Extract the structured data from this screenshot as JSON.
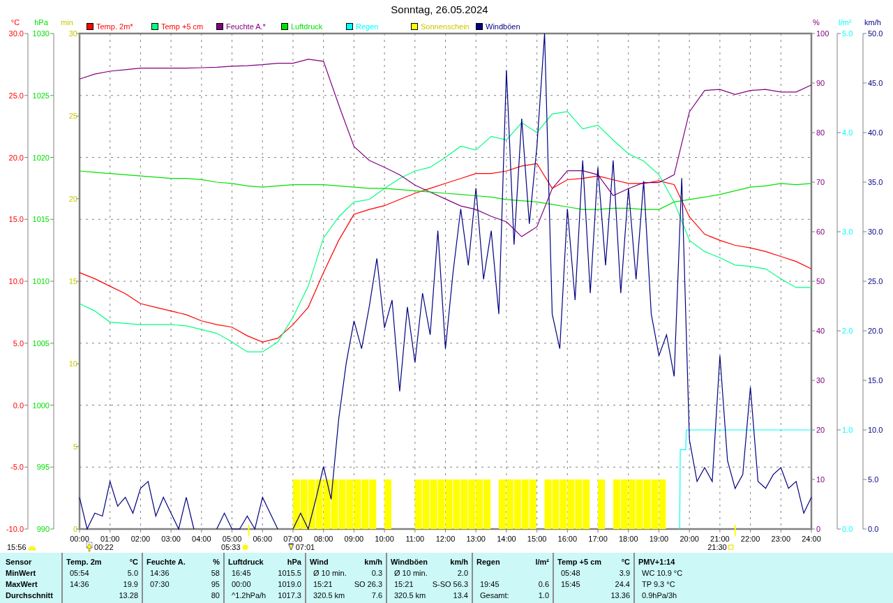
{
  "chart_layers": [
    {
      "chart_data": {
        "type": "line",
        "title": "Sonntag, 26.05.2024",
        "ylabel": "°C",
        "legend": "top",
        "grid": true,
        "x": [
          0,
          0.5,
          1,
          1.5,
          2,
          2.5,
          3,
          3.5,
          4,
          4.5,
          5,
          5.5,
          6,
          6.5,
          7,
          7.5,
          8,
          8.5,
          9,
          9.5,
          10,
          10.5,
          11,
          11.5,
          12,
          12.5,
          13,
          13.5,
          14,
          14.5,
          15,
          15.5,
          16,
          16.5,
          17,
          17.5,
          18,
          18.5,
          19,
          19.5,
          20,
          20.5,
          21,
          21.5,
          22,
          22.5,
          23,
          23.5,
          24
        ],
        "xlim": [
          0,
          24
        ],
        "xticks": [
          {
            "value": 0,
            "label": "00:00"
          },
          {
            "value": 1,
            "label": "01:00"
          },
          {
            "value": 2,
            "label": "02:00"
          },
          {
            "value": 3,
            "label": "03:00"
          },
          {
            "value": 4,
            "label": "04:00"
          },
          {
            "value": 5,
            "label": "05:00"
          },
          {
            "value": 6,
            "label": "06:00"
          },
          {
            "value": 7,
            "label": "07:00"
          },
          {
            "value": 8,
            "label": "08:00"
          },
          {
            "value": 9,
            "label": "09:00"
          },
          {
            "value": 10,
            "label": "10:00"
          },
          {
            "value": 11,
            "label": "11:00"
          },
          {
            "value": 12,
            "label": "12:00"
          },
          {
            "value": 13,
            "label": "13:00"
          },
          {
            "value": 14,
            "label": "14:00"
          },
          {
            "value": 15,
            "label": "15:00"
          },
          {
            "value": 16,
            "label": "16:00"
          },
          {
            "value": 17,
            "label": "17:00"
          },
          {
            "value": 18,
            "label": "18:00"
          },
          {
            "value": 19,
            "label": "19:00"
          },
          {
            "value": 20,
            "label": "20:00"
          },
          {
            "value": 21,
            "label": "21:00"
          },
          {
            "value": 22,
            "label": "22:00"
          },
          {
            "value": 23,
            "label": "23:00"
          },
          {
            "value": 24,
            "label": "24:00"
          }
        ],
        "ylim": [
          -10,
          30
        ],
        "yticks": [
          {
            "value": 30,
            "label": "30.0"
          },
          {
            "value": 25,
            "label": "25.0"
          },
          {
            "value": 20,
            "label": "20.0"
          },
          {
            "value": 15,
            "label": "15.0"
          },
          {
            "value": 10,
            "label": "10.0"
          },
          {
            "value": 5,
            "label": "5.0"
          },
          {
            "value": 0,
            "label": "0.0"
          },
          {
            "value": -5,
            "label": "-5.0"
          },
          {
            "value": -10,
            "label": "-10.0"
          }
        ],
        "series": [
          {
            "name": "Temp. 2m*",
            "color": "#ff0000",
            "values": [
              10.7,
              10.2,
              9.6,
              9.0,
              8.2,
              7.9,
              7.6,
              7.3,
              6.8,
              6.5,
              6.3,
              5.6,
              5.1,
              5.4,
              6.5,
              7.9,
              10.7,
              13.3,
              15.4,
              15.8,
              16.1,
              16.6,
              17.1,
              17.5,
              17.9,
              18.3,
              18.7,
              18.7,
              18.9,
              19.3,
              19.5,
              17.5,
              18.2,
              18.3,
              18.5,
              18.2,
              17.9,
              17.9,
              18.1,
              17.8,
              15.2,
              13.8,
              13.3,
              12.9,
              12.7,
              12.4,
              12.0,
              11.6,
              11.0
            ]
          },
          {
            "name": "Temp +5 cm",
            "color": "#00ff80",
            "values": [
              8.2,
              7.6,
              6.7,
              6.6,
              6.5,
              6.5,
              6.5,
              6.4,
              6.1,
              5.8,
              5.1,
              4.3,
              4.3,
              5.1,
              7.1,
              9.6,
              13.5,
              15.2,
              16.4,
              16.6,
              17.5,
              18.3,
              18.9,
              19.2,
              20.0,
              20.9,
              20.6,
              21.7,
              21.4,
              22.8,
              22.0,
              23.5,
              23.7,
              22.3,
              22.6,
              21.4,
              20.3,
              19.7,
              18.6,
              16.4,
              13.3,
              12.4,
              11.9,
              11.3,
              11.2,
              11.0,
              10.2,
              9.5,
              9.5
            ]
          }
        ],
        "annotations": [
          "00:22",
          "05:33",
          "07:01",
          "21:30"
        ]
      }
    },
    {
      "chart_data": {
        "type": "line",
        "ylabel": "%",
        "legend": "top",
        "x": [
          0,
          0.5,
          1,
          1.5,
          2,
          2.5,
          3,
          3.5,
          4,
          4.5,
          5,
          5.5,
          6,
          6.5,
          7,
          7.5,
          8,
          8.5,
          9,
          9.5,
          10,
          10.5,
          11,
          11.5,
          12,
          12.5,
          13,
          13.5,
          14,
          14.5,
          15,
          15.5,
          16,
          16.5,
          17,
          17.5,
          18,
          18.5,
          19,
          19.5,
          20,
          20.5,
          21,
          21.5,
          22,
          22.5,
          23,
          23.5,
          24
        ],
        "xlim": [
          0,
          24
        ],
        "ylim": [
          0,
          100
        ],
        "yticks": [
          100,
          90,
          80,
          70,
          60,
          50,
          40,
          30,
          20,
          10,
          0
        ],
        "series": [
          {
            "name": "Feuchte A.*",
            "color": "#800080",
            "values": [
              90.8,
              91.8,
              92.4,
              92.7,
              93.0,
              93.0,
              93.0,
              93.0,
              93.1,
              93.2,
              93.4,
              93.5,
              93.7,
              94.0,
              94.0,
              94.8,
              94.4,
              85.6,
              77.2,
              74.4,
              73.0,
              71.5,
              69.4,
              68.0,
              66.6,
              65.2,
              64.5,
              63.1,
              62.0,
              59.0,
              61.0,
              68.7,
              72.3,
              72.3,
              71.5,
              67.3,
              68.7,
              69.9,
              69.9,
              71.5,
              84.2,
              88.5,
              88.7,
              87.7,
              88.5,
              88.7,
              88.2,
              88.2,
              89.6
            ]
          }
        ]
      }
    },
    {
      "chart_data": {
        "type": "line",
        "ylabel": "hPa",
        "legend": "top",
        "x": [
          0,
          0.5,
          1,
          1.5,
          2,
          2.5,
          3,
          3.5,
          4,
          4.5,
          5,
          5.5,
          6,
          6.5,
          7,
          7.5,
          8,
          8.5,
          9,
          9.5,
          10,
          10.5,
          11,
          11.5,
          12,
          12.5,
          13,
          13.5,
          14,
          14.5,
          15,
          15.5,
          16,
          16.5,
          17,
          17.5,
          18,
          18.5,
          19,
          19.5,
          20,
          20.5,
          21,
          21.5,
          22,
          22.5,
          23,
          23.5,
          24
        ],
        "xlim": [
          0,
          24
        ],
        "ylim": [
          990,
          1030
        ],
        "yticks": [
          1030,
          1025,
          1020,
          1015,
          1010,
          1005,
          1000,
          995,
          990
        ],
        "series": [
          {
            "name": "Luftdruck",
            "color": "#00e000",
            "values": [
              1018.9,
              1018.8,
              1018.7,
              1018.6,
              1018.5,
              1018.4,
              1018.3,
              1018.3,
              1018.2,
              1018.0,
              1017.9,
              1017.7,
              1017.6,
              1017.7,
              1017.8,
              1017.8,
              1017.8,
              1017.7,
              1017.6,
              1017.5,
              1017.5,
              1017.4,
              1017.3,
              1017.2,
              1017.1,
              1017.0,
              1016.9,
              1016.8,
              1016.6,
              1016.5,
              1016.4,
              1016.2,
              1016.0,
              1015.8,
              1015.8,
              1015.9,
              1015.9,
              1015.8,
              1015.8,
              1016.4,
              1016.6,
              1016.8,
              1017.0,
              1017.3,
              1017.6,
              1017.7,
              1017.9,
              1017.8,
              1017.9
            ]
          }
        ]
      }
    },
    {
      "chart_data": {
        "type": "line",
        "ylabel": "l/m²",
        "legend": "top",
        "x": [
          19.68,
          19.7,
          19.88,
          19.9,
          24
        ],
        "xlim": [
          0,
          24
        ],
        "ylim": [
          0,
          5
        ],
        "yticks": [
          {
            "value": 5,
            "label": "5.0"
          },
          {
            "value": 4,
            "label": "4.0"
          },
          {
            "value": 3,
            "label": "3.0"
          },
          {
            "value": 2,
            "label": "2.0"
          },
          {
            "value": 1,
            "label": "1.0"
          },
          {
            "value": 0,
            "label": "0.0"
          }
        ],
        "series": [
          {
            "name": "Regen",
            "color": "#00ffff",
            "values": [
              0,
              0.8,
              0.8,
              1,
              1
            ]
          }
        ]
      }
    },
    {
      "chart_data": {
        "type": "bar",
        "ylabel": "min",
        "legend": "top",
        "x": [
          0,
          0.25,
          0.5,
          0.75,
          1,
          1.25,
          1.5,
          1.75,
          2,
          2.25,
          2.5,
          2.75,
          3,
          3.25,
          3.5,
          3.75,
          4,
          4.25,
          4.5,
          4.75,
          5,
          5.25,
          5.5,
          5.75,
          6,
          6.25,
          6.5,
          6.75,
          7,
          7.25,
          7.5,
          7.75,
          8,
          8.25,
          8.5,
          8.75,
          9,
          9.25,
          9.5,
          9.75,
          10,
          10.25,
          10.5,
          10.75,
          11,
          11.25,
          11.5,
          11.75,
          12,
          12.25,
          12.5,
          12.75,
          13,
          13.25,
          13.5,
          13.75,
          14,
          14.25,
          14.5,
          14.75,
          15,
          15.25,
          15.5,
          15.75,
          16,
          16.25,
          16.5,
          16.75,
          17,
          17.25,
          17.5,
          17.75,
          18,
          18.25,
          18.5,
          18.75,
          19,
          19.25,
          19.5,
          19.75,
          20,
          20.25,
          20.5,
          20.75,
          21,
          21.25,
          21.5,
          21.75,
          22,
          22.25,
          22.5,
          22.75,
          23,
          23.25,
          23.5,
          23.75,
          24
        ],
        "xlim": [
          0,
          24
        ],
        "ylim": [
          0,
          30
        ],
        "yticks": [
          30,
          25,
          20,
          15,
          10,
          5,
          0
        ],
        "series": [
          {
            "name": "Sonnenschein",
            "color": "#ffff00",
            "values": [
              0,
              0,
              0,
              0,
              0,
              0,
              0,
              0,
              0,
              0,
              0,
              0,
              0,
              0,
              0,
              0,
              0,
              0,
              0,
              0,
              0,
              0,
              0,
              0,
              0,
              0,
              0,
              0,
              3,
              3,
              3,
              3,
              3,
              3,
              3,
              3,
              3,
              3,
              3,
              0,
              3,
              0,
              0,
              0,
              3,
              3,
              3,
              3,
              3,
              3,
              3,
              3,
              3,
              3,
              0,
              3,
              3,
              3,
              3,
              3,
              0,
              3,
              3,
              3,
              3,
              3,
              3,
              0,
              3,
              0,
              3,
              3,
              3,
              3,
              3,
              3,
              3,
              0,
              0,
              0,
              0,
              0,
              0,
              0,
              0,
              0,
              0,
              0,
              0,
              0,
              0,
              0,
              0,
              0,
              0,
              0,
              0
            ]
          }
        ]
      }
    },
    {
      "chart_data": {
        "type": "line",
        "ylabel": "km/h",
        "legend": "top",
        "x": [
          0,
          0.25,
          0.5,
          0.75,
          1,
          1.25,
          1.5,
          1.75,
          2,
          2.25,
          2.5,
          2.75,
          3,
          3.25,
          3.5,
          3.75,
          4,
          4.25,
          4.5,
          4.75,
          5,
          5.25,
          5.5,
          5.75,
          6,
          6.25,
          6.5,
          6.75,
          7,
          7.25,
          7.5,
          7.75,
          8,
          8.25,
          8.5,
          8.75,
          9,
          9.25,
          9.5,
          9.75,
          10,
          10.25,
          10.5,
          10.75,
          11,
          11.25,
          11.5,
          11.75,
          12,
          12.25,
          12.5,
          12.75,
          13,
          13.25,
          13.5,
          13.75,
          14,
          14.25,
          14.5,
          14.75,
          15,
          15.25,
          15.5,
          15.75,
          16,
          16.25,
          16.5,
          16.75,
          17,
          17.25,
          17.5,
          17.75,
          18,
          18.25,
          18.5,
          18.75,
          19,
          19.25,
          19.5,
          19.75,
          20,
          20.25,
          20.5,
          20.75,
          21,
          21.25,
          21.5,
          21.75,
          22,
          22.25,
          22.5,
          22.75,
          23,
          23.25,
          23.5,
          23.75,
          24
        ],
        "xlim": [
          0,
          24
        ],
        "ylim": [
          0,
          50
        ],
        "yticks": [
          {
            "value": 50,
            "label": "50.0"
          },
          {
            "value": 45,
            "label": "45.0"
          },
          {
            "value": 40,
            "label": "40.0"
          },
          {
            "value": 35,
            "label": "35.0"
          },
          {
            "value": 30,
            "label": "30.0"
          },
          {
            "value": 25,
            "label": "25.0"
          },
          {
            "value": 20,
            "label": "20.0"
          },
          {
            "value": 15,
            "label": "15.0"
          },
          {
            "value": 10,
            "label": "10.0"
          },
          {
            "value": 5,
            "label": "5.0"
          },
          {
            "value": 0,
            "label": "0.0"
          }
        ],
        "series": [
          {
            "name": "Windböen",
            "color": "#000080",
            "values": [
              3.2,
              0,
              1.6,
              1.3,
              4.8,
              2.3,
              3.2,
              1.6,
              4.1,
              4.8,
              1.3,
              3.2,
              1.6,
              0,
              3.2,
              0,
              null,
              null,
              0,
              1.6,
              0,
              0,
              1.3,
              0,
              3.2,
              1.6,
              0,
              null,
              0,
              1.6,
              0,
              3.0,
              6.3,
              3.0,
              11.1,
              16.8,
              21.0,
              18.2,
              22.4,
              27.3,
              20.3,
              23.1,
              13.9,
              22.4,
              16.8,
              23.8,
              19.6,
              30.1,
              18.2,
              25.9,
              32.3,
              26.6,
              34.4,
              25.2,
              30.1,
              21.7,
              46.3,
              28.7,
              41.4,
              30.8,
              38.6,
              50,
              21.7,
              18.2,
              32.3,
              23.1,
              37.2,
              23.8,
              36.5,
              26.6,
              37.2,
              23.8,
              34.4,
              25.2,
              35.1,
              21.7,
              17.5,
              19.6,
              15.4,
              35.4,
              9.0,
              4.8,
              6.2,
              4.8,
              17.5,
              6.9,
              4.1,
              5.5,
              14.3,
              4.8,
              4.1,
              5.5,
              6.2,
              4.1,
              4.8,
              1.6,
              3.2
            ]
          }
        ]
      }
    }
  ],
  "day_length": {
    "time": "15:56"
  },
  "table": {
    "corner": "Sensor",
    "columns": [
      {
        "name": "Temp. 2m",
        "unit": "°C"
      },
      {
        "name": "Feuchte A.",
        "unit": "%"
      },
      {
        "name": "Luftdruck",
        "unit": "hPa"
      },
      {
        "name": "Wind",
        "unit": "km/h"
      },
      {
        "name": "Windböen",
        "unit": "km/h"
      },
      {
        "name": "Regen",
        "unit": "l/m²"
      },
      {
        "name": "Temp +5 cm",
        "unit": "°C"
      },
      {
        "name": "PMV+1:14"
      }
    ],
    "rows": [
      {
        "label": "MinWert",
        "cells": [
          {
            "note": "05:54",
            "value": "5.0"
          },
          {
            "note": "14:36",
            "value": "58"
          },
          {
            "note": "16:45",
            "value": "1015.5"
          },
          {
            "note": "Ø 10 min.",
            "value": "0.3"
          },
          {
            "note": "Ø 10 min.",
            "value": "2.0"
          },
          {},
          {
            "note": "05:48",
            "value": "3.9"
          },
          {
            "note": "WC 10.9 °C"
          }
        ]
      },
      {
        "label": "MaxWert",
        "cells": [
          {
            "note": "14:36",
            "value": "19.9"
          },
          {
            "note": "07:30",
            "value": "95"
          },
          {
            "note": "00:00",
            "value": "1019.0"
          },
          {
            "note": "15:21",
            "value": "SO 26.3"
          },
          {
            "note": "15:21",
            "value": "S-SO 56.3"
          },
          {
            "note": "19:45",
            "value": "0.6"
          },
          {
            "note": "15:45",
            "value": "24.4"
          },
          {
            "note": "TP 9.3 °C"
          }
        ]
      },
      {
        "label": "Durchschnitt",
        "cells": [
          {
            "value": "13.28"
          },
          {
            "value": "80"
          },
          {
            "note": "^1.2hPa/h",
            "value": "1017.3"
          },
          {
            "note": "320.5 km",
            "value": "7.6"
          },
          {
            "note": "320.5 km",
            "value": "13.4"
          },
          {
            "note": "Gesamt:",
            "value": "1.0"
          },
          {
            "value": "13.36"
          },
          {
            "note": "0.9hPa/3h"
          }
        ]
      }
    ]
  }
}
